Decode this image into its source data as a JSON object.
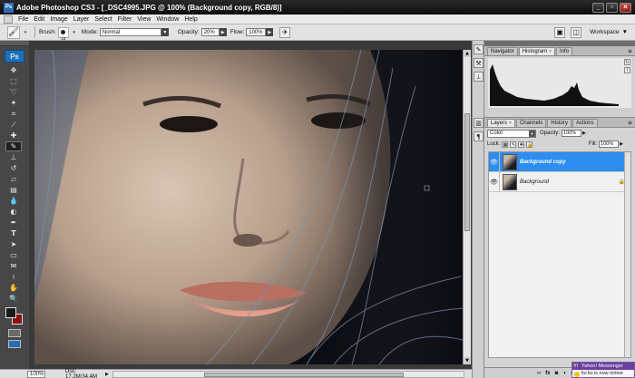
{
  "titlebar": {
    "app_icon": "Ps",
    "title": "Adobe Photoshop CS3 - [_DSC4995.JPG @ 100% (Background copy, RGB/8)]",
    "buttons": [
      "minimize",
      "restore",
      "close"
    ]
  },
  "menubar": {
    "items": [
      "File",
      "Edit",
      "Image",
      "Layer",
      "Select",
      "Filter",
      "View",
      "Window",
      "Help"
    ]
  },
  "options": {
    "tool_icon": "brush-icon",
    "brush_label": "Brush:",
    "brush_size": "15",
    "mode_label": "Mode:",
    "mode_value": "Normal",
    "opacity_label": "Opacity:",
    "opacity_value": "20%",
    "flow_label": "Flow:",
    "flow_value": "100%",
    "workspace_label": "Workspace"
  },
  "toolbox": {
    "logo": "Ps",
    "tools": [
      "move-tool",
      "marquee-tool",
      "lasso-tool",
      "magic-wand-tool",
      "crop-tool",
      "slice-tool",
      "healing-brush-tool",
      "brush-tool",
      "clone-stamp-tool",
      "history-brush-tool",
      "eraser-tool",
      "gradient-tool",
      "blur-tool",
      "dodge-tool",
      "pen-tool",
      "type-tool",
      "path-selection-tool",
      "shape-tool",
      "notes-tool",
      "eyedropper-tool",
      "hand-tool",
      "zoom-tool"
    ],
    "active_tool": "brush-tool",
    "foreground_color": "#1a1a1a",
    "background_color": "#8b0f0f"
  },
  "status": {
    "zoom": "100%",
    "doc_info": "Doc: 17.2M/34.4M"
  },
  "navigator_panel": {
    "tabs": [
      "Navigator",
      "Histogram",
      "Info"
    ],
    "active_tab": "Histogram"
  },
  "layers_panel": {
    "tabs": [
      "Layers",
      "Channels",
      "History",
      "Actions"
    ],
    "active_tab": "Layers",
    "blend_mode": "Color",
    "opacity_label": "Opacity:",
    "opacity_value": "100%",
    "lock_label": "Lock:",
    "fill_label": "Fill:",
    "fill_value": "100%",
    "layers": [
      {
        "name": "Background copy",
        "selected": true,
        "locked": false
      },
      {
        "name": "Background",
        "selected": false,
        "locked": true
      }
    ],
    "footer_icons": [
      "link-icon",
      "fx-icon",
      "mask-icon",
      "adjustment-icon",
      "group-icon",
      "new-layer-icon",
      "trash-icon"
    ]
  },
  "yahoo_popup": {
    "title": "Yahoo! Messenger",
    "message": "liu liu is now online"
  }
}
